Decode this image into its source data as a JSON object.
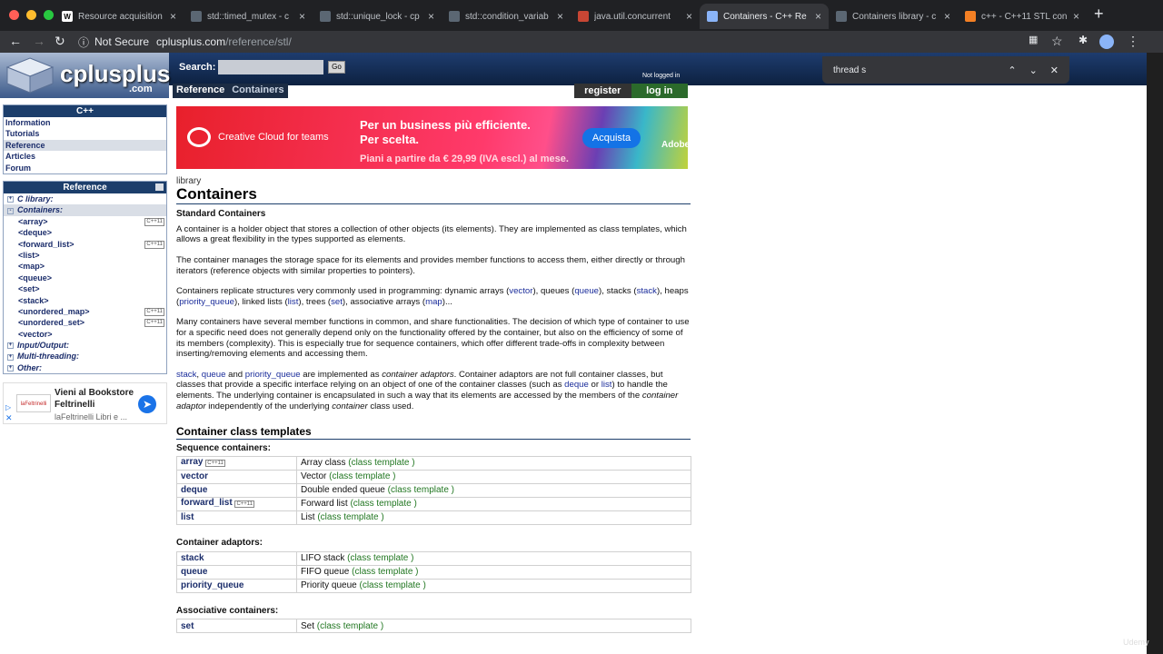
{
  "browser": {
    "tabs": [
      {
        "title": "Resource acquisition",
        "favicon": "W"
      },
      {
        "title": "std::timed_mutex - c",
        "favicon": "cpp"
      },
      {
        "title": "std::unique_lock - cp",
        "favicon": "cpp"
      },
      {
        "title": "std::condition_variab",
        "favicon": "cpp"
      },
      {
        "title": "java.util.concurrent",
        "favicon": "oracle"
      },
      {
        "title": "Containers - C++ Re",
        "favicon": "cplusplus"
      },
      {
        "title": "Containers library - c",
        "favicon": "cpp"
      },
      {
        "title": "c++ - C++11 STL con",
        "favicon": "so"
      }
    ],
    "active_tab": 5,
    "not_secure": "Not Secure",
    "url_host": "cplusplus.com",
    "url_path": "/reference/stl/",
    "find_query": "thread s"
  },
  "site": {
    "logo": "cplusplus",
    "logo_domain": ".com",
    "search_label": "Search:",
    "go": "Go",
    "not_logged": "Not logged in",
    "crumbs": [
      "Reference",
      "Containers"
    ],
    "register": "register",
    "login": "log in"
  },
  "sidebar": {
    "cpp_head": "C++",
    "cpp_items": [
      "Information",
      "Tutorials",
      "Reference",
      "Articles",
      "Forum"
    ],
    "ref_head": "Reference",
    "cats": [
      {
        "label": "C library:",
        "pm": "+"
      },
      {
        "label": "Containers:",
        "pm": "-"
      }
    ],
    "containers": [
      {
        "label": "<array>",
        "badge": "C++11"
      },
      {
        "label": "<deque>",
        "badge": ""
      },
      {
        "label": "<forward_list>",
        "badge": "C++11"
      },
      {
        "label": "<list>",
        "badge": ""
      },
      {
        "label": "<map>",
        "badge": ""
      },
      {
        "label": "<queue>",
        "badge": ""
      },
      {
        "label": "<set>",
        "badge": ""
      },
      {
        "label": "<stack>",
        "badge": ""
      },
      {
        "label": "<unordered_map>",
        "badge": "C++11"
      },
      {
        "label": "<unordered_set>",
        "badge": "C++11"
      },
      {
        "label": "<vector>",
        "badge": ""
      }
    ],
    "cats2": [
      "Input/Output:",
      "Multi-threading:",
      "Other:"
    ],
    "ad": {
      "brand": "laFeltrinelli",
      "line1": "Vieni al Bookstore",
      "line2": "Feltrinelli",
      "line3": "laFeltrinelli Libri e ..."
    }
  },
  "banner": {
    "product": "Creative Cloud for teams",
    "line1": "Per un business più efficiente.",
    "line2": "Per scelta.",
    "line3": "Piani a partire da € 29,99 (IVA escl.) al mese.",
    "cta": "Acquista",
    "brand": "Adobe"
  },
  "main": {
    "kicker": "library",
    "title": "Containers",
    "subtitle": "Standard Containers",
    "p1": "A container is a holder object that stores a collection of other objects (its elements). They are implemented as class templates, which allows a great flexibility in the types supported as elements.",
    "p2": "The container manages the storage space for its elements and provides member functions to access them, either directly or through iterators (reference objects with similar properties to pointers).",
    "p3a": "Containers replicate structures very commonly used in programming: dynamic arrays (",
    "p3_vector": "vector",
    "p3b": "), queues (",
    "p3_queue": "queue",
    "p3c": "), stacks (",
    "p3_stack": "stack",
    "p3d": "), heaps (",
    "p3_pq": "priority_queue",
    "p3e": "), linked lists (",
    "p3_list": "list",
    "p3f": "), trees (",
    "p3_set": "set",
    "p3g": "), associative arrays (",
    "p3_map": "map",
    "p3h": ")...",
    "p4": "Many containers have several member functions in common, and share functionalities. The decision of which type of container to use for a specific need does not generally depend only on the functionality offered by the container, but also on the efficiency of some of its members (complexity). This is especially true for sequence containers, which offer different trade-offs in complexity between inserting/removing elements and accessing them.",
    "p5_stack": "stack",
    "p5_sep": ", ",
    "p5_queue": "queue",
    "p5_and": " and ",
    "p5_pq": "priority_queue",
    "p5a": " are implemented as ",
    "p5_ca": "container adaptors",
    "p5b": ". Container adaptors are not full container classes, but classes that provide a specific interface relying on an object of one of the container classes (such as ",
    "p5_deque": "deque",
    "p5_or": " or ",
    "p5_list": "list",
    "p5c": ") to handle the elements. The underlying container is encapsulated in such a way that its elements are accessed by the members of the ",
    "p5_ca2": "container adaptor",
    "p5d": " independently of the underlying ",
    "p5_cont": "container",
    "p5e": " class used.",
    "section": "Container class templates",
    "groups": [
      {
        "label": "Sequence containers",
        "rows": [
          {
            "name": "array",
            "badge": "C++11",
            "desc": "Array class",
            "kind": "(class template )"
          },
          {
            "name": "vector",
            "badge": "",
            "desc": "Vector",
            "kind": "(class template )"
          },
          {
            "name": "deque",
            "badge": "",
            "desc": "Double ended queue",
            "kind": "(class template )"
          },
          {
            "name": "forward_list",
            "badge": "C++11",
            "desc": "Forward list",
            "kind": "(class template )"
          },
          {
            "name": "list",
            "badge": "",
            "desc": "List",
            "kind": "(class template )"
          }
        ]
      },
      {
        "label": "Container adaptors",
        "rows": [
          {
            "name": "stack",
            "badge": "",
            "desc": "LIFO stack",
            "kind": "(class template )"
          },
          {
            "name": "queue",
            "badge": "",
            "desc": "FIFO queue",
            "kind": "(class template )"
          },
          {
            "name": "priority_queue",
            "badge": "",
            "desc": "Priority queue",
            "kind": "(class template )"
          }
        ]
      },
      {
        "label": "Associative containers",
        "rows": [
          {
            "name": "set",
            "badge": "",
            "desc": "Set",
            "kind": "(class template )"
          }
        ]
      }
    ]
  },
  "watermark": "Udemy"
}
